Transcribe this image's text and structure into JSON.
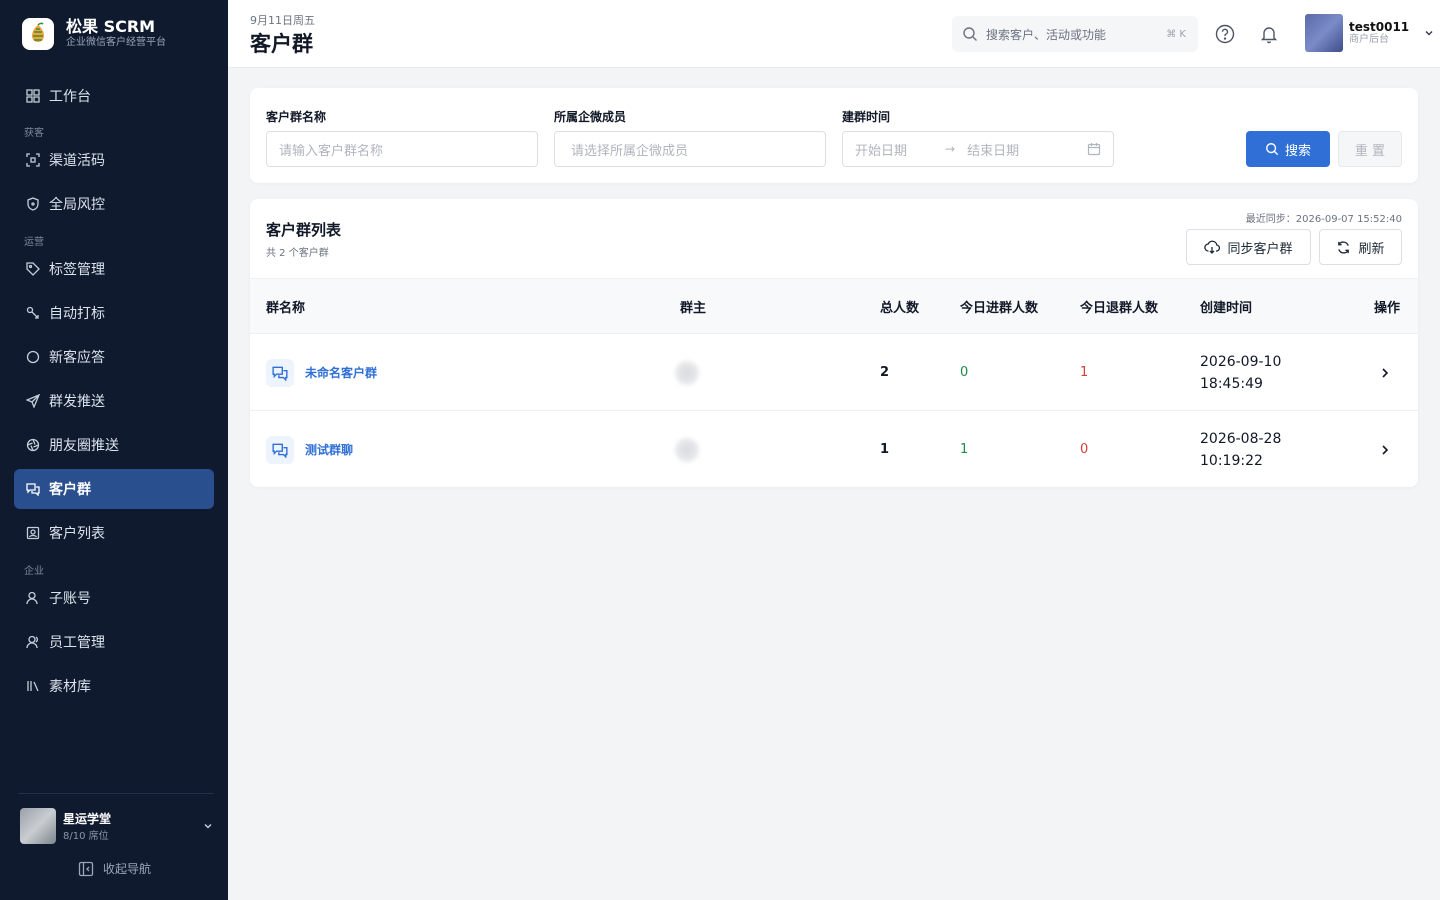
{
  "brand": {
    "name": "松果 SCRM",
    "subtitle": "企业微信客户经营平台"
  },
  "nav": {
    "workbench": "工作台",
    "section_acquire": "获客",
    "channel_code": "渠道活码",
    "risk_control": "全局风控",
    "section_ops": "运营",
    "tag_mgmt": "标签管理",
    "auto_tag": "自动打标",
    "new_customer": "新客应答",
    "mass_push": "群发推送",
    "moments_push": "朋友圈推送",
    "customer_groups": "客户群",
    "customer_list": "客户列表",
    "section_company": "企业",
    "sub_accounts": "子账号",
    "staff_mgmt": "员工管理",
    "materials": "素材库"
  },
  "workspace": {
    "name": "星运学堂",
    "seats": "8/10 席位"
  },
  "collapse_label": "收起导航",
  "header": {
    "date": "9月11日周五",
    "title": "客户群"
  },
  "search": {
    "placeholder": "搜索客户、活动或功能",
    "shortcut": "⌘ K"
  },
  "user": {
    "name": "test0011",
    "role": "商户后台"
  },
  "filters": {
    "group_name_label": "客户群名称",
    "group_name_placeholder": "请输入客户群名称",
    "member_label": "所属企微成员",
    "member_placeholder": "请选择所属企微成员",
    "created_label": "建群时间",
    "start_placeholder": "开始日期",
    "end_placeholder": "结束日期",
    "search_btn": "搜索",
    "reset_btn": "重 置"
  },
  "list": {
    "title": "客户群列表",
    "count_text": "共 2 个客户群",
    "last_sync": "最近同步：2026-09-07 15:52:40",
    "sync_btn": "同步客户群",
    "refresh_btn": "刷新",
    "columns": [
      "群名称",
      "群主",
      "总人数",
      "今日进群人数",
      "今日退群人数",
      "创建时间",
      "操作"
    ],
    "rows": [
      {
        "name": "未命名客户群",
        "total": "2",
        "joined": "0",
        "left": "1",
        "date": "2026-09-10",
        "time": "18:45:49"
      },
      {
        "name": "测试群聊",
        "total": "1",
        "joined": "1",
        "left": "0",
        "date": "2026-08-28",
        "time": "10:19:22"
      }
    ]
  },
  "colors": {
    "sidebar_bg": "#0f1a2e",
    "accent": "#2f6fd6",
    "active_nav": "#2a4f8f",
    "green": "#1f8a4c",
    "red": "#d0413c"
  }
}
